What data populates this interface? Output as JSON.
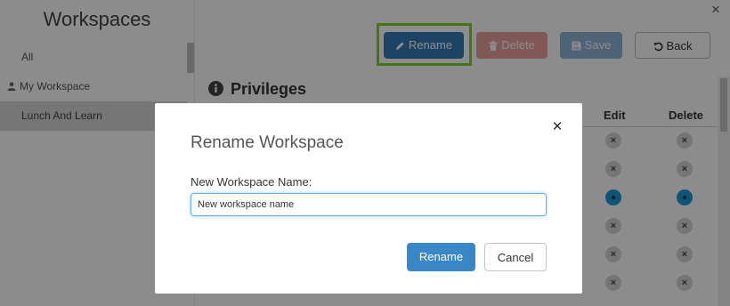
{
  "sidebar": {
    "title": "Workspaces",
    "items": [
      {
        "label": "All",
        "selected": false,
        "icon": ""
      },
      {
        "label": "My Workspace",
        "selected": false,
        "icon": "user-icon"
      },
      {
        "label": "Lunch And Learn",
        "selected": true,
        "icon": ""
      }
    ]
  },
  "window": {
    "close_glyph": "×"
  },
  "toolbar": {
    "rename_label": "Rename",
    "delete_label": "Delete",
    "save_label": "Save",
    "back_label": "Back",
    "highlight_color": "#7ed321"
  },
  "privileges": {
    "heading": "Privileges",
    "columns": [
      "Edit",
      "Delete"
    ],
    "rows": [
      {
        "edit": false,
        "delete": false
      },
      {
        "edit": false,
        "delete": false
      },
      {
        "edit": true,
        "delete": true
      },
      {
        "edit": false,
        "delete": false
      },
      {
        "edit": false,
        "delete": false
      },
      {
        "edit": false,
        "delete": false
      }
    ],
    "off_glyph": "×",
    "on_color": "#1e9ad6",
    "off_color": "#d6d6d6"
  },
  "modal": {
    "title": "Rename Workspace",
    "close_glyph": "×",
    "field_label": "New Workspace Name:",
    "field_value": "New workspace name",
    "rename_label": "Rename",
    "cancel_label": "Cancel",
    "accent_color": "#3a87c8"
  }
}
